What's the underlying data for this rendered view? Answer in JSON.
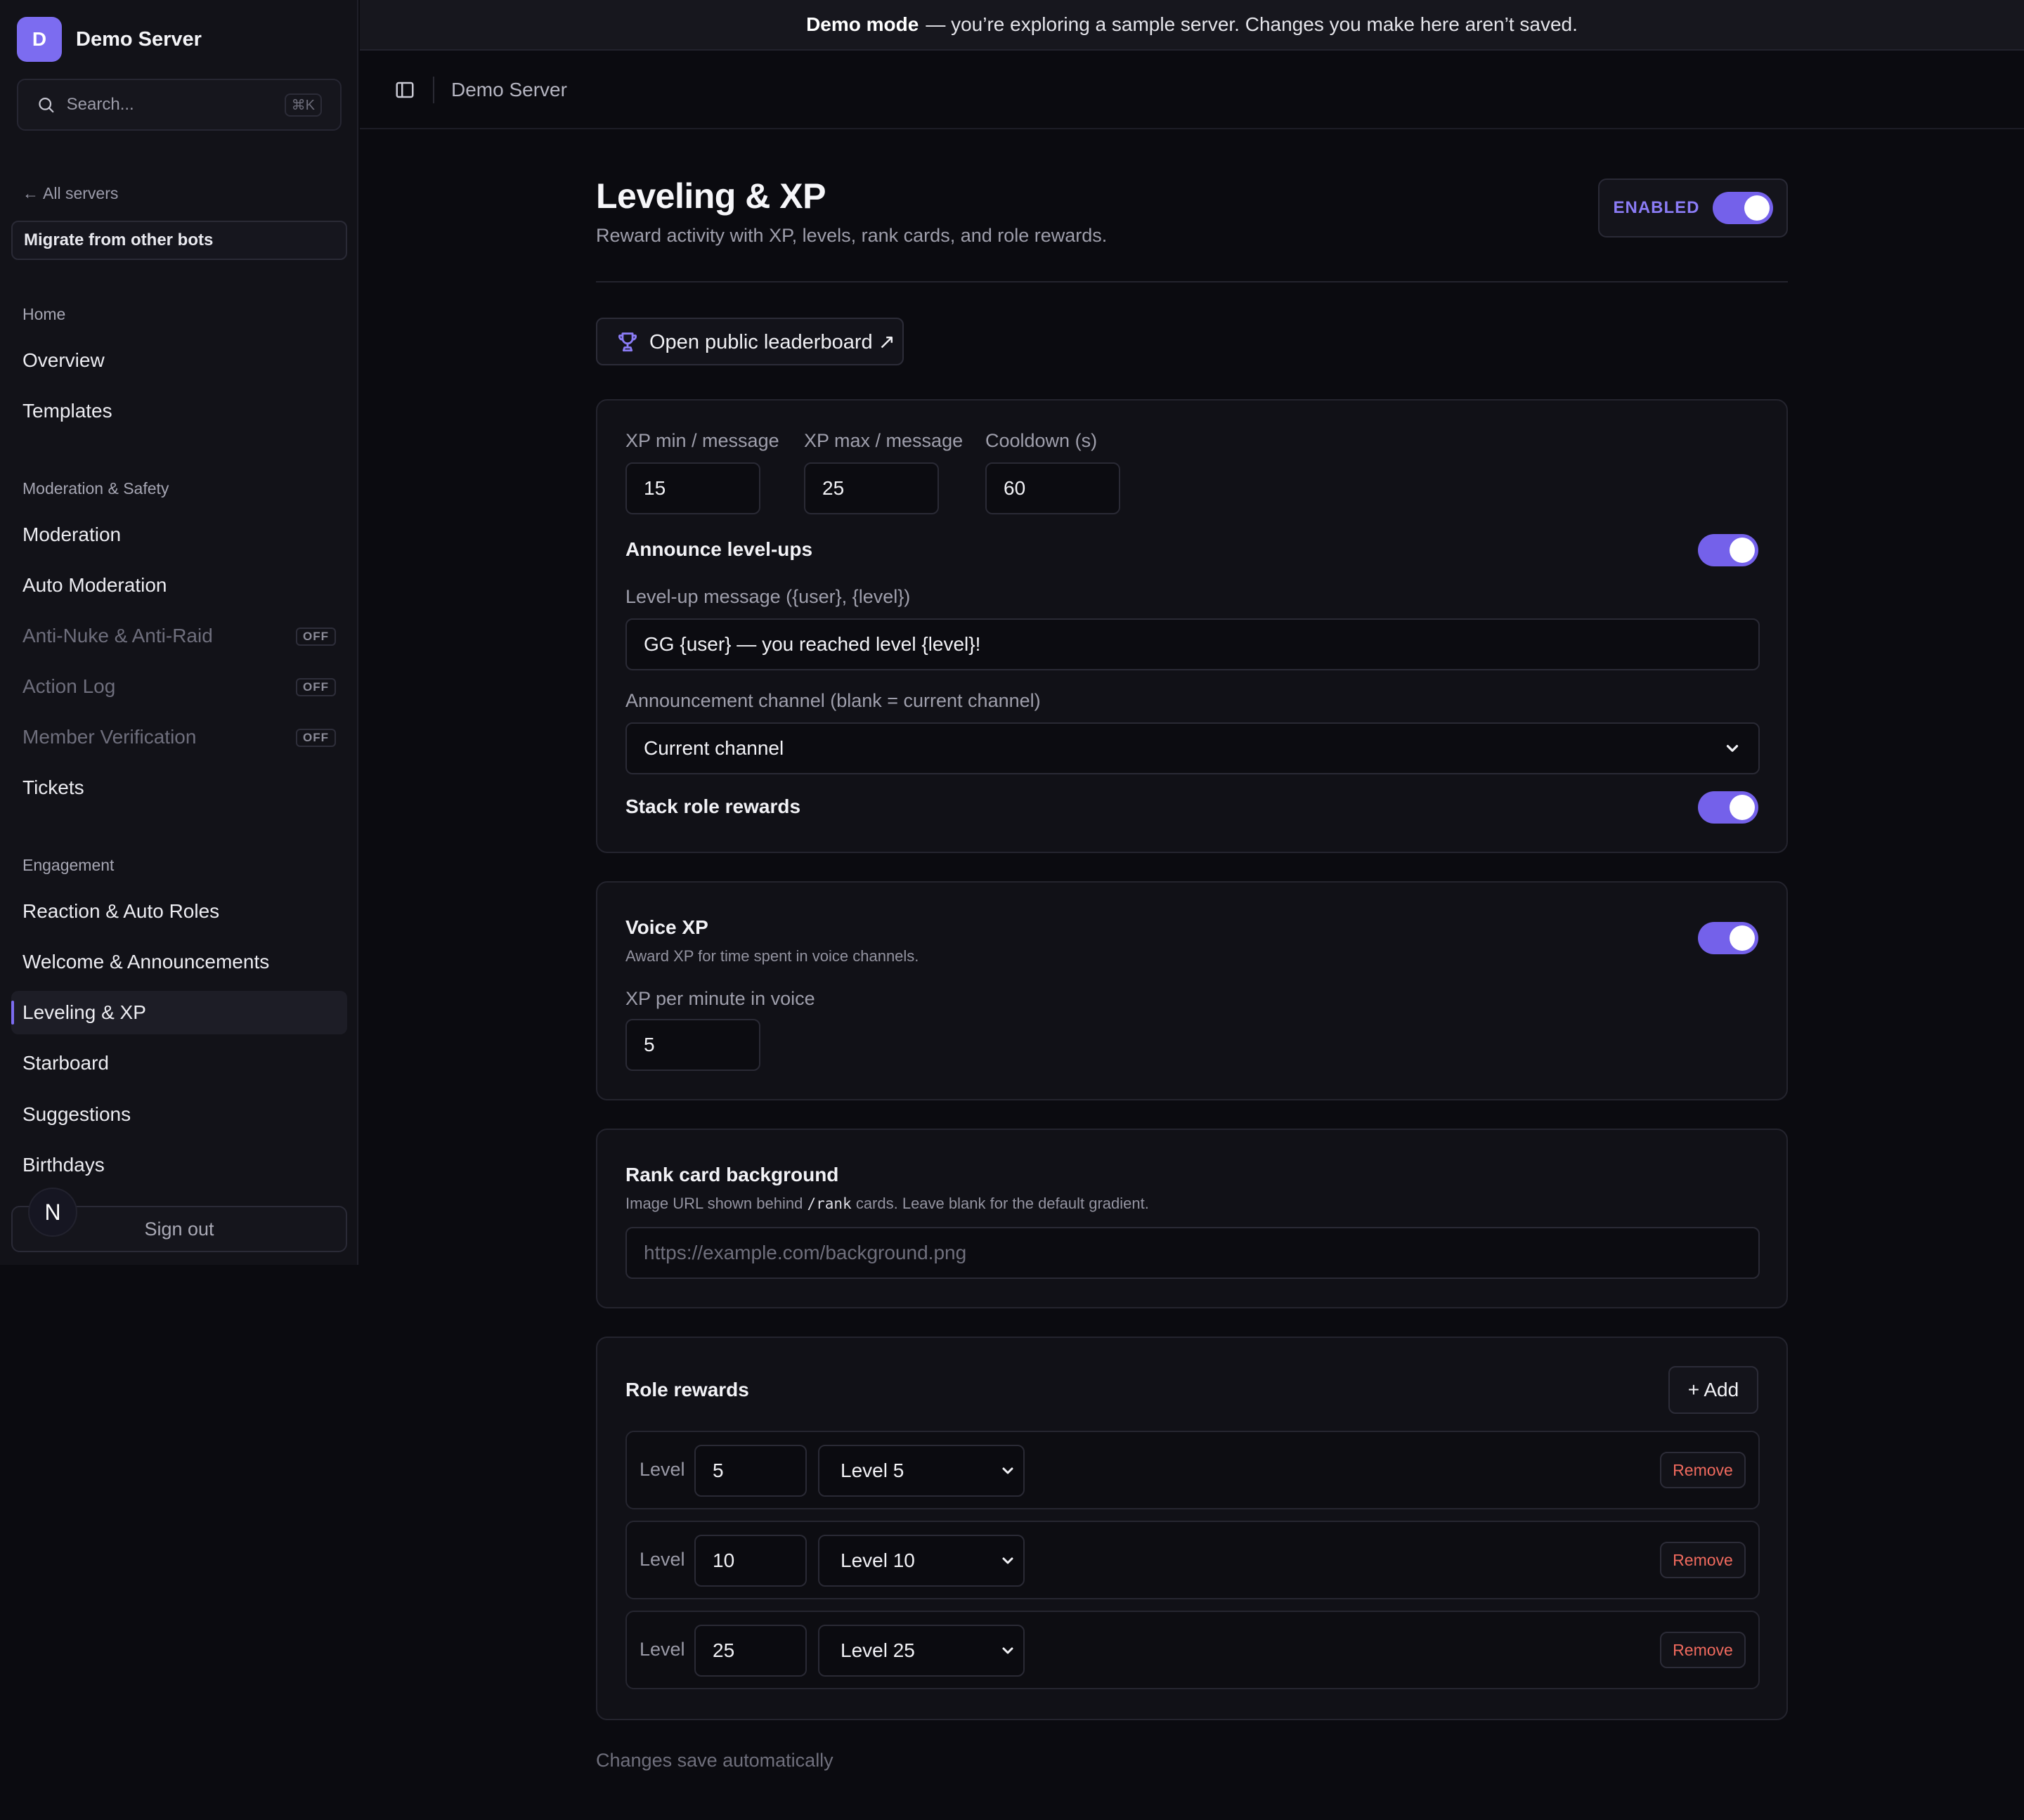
{
  "banner": {
    "bold": "Demo mode",
    "text": "— you’re exploring a sample server. Changes you make here aren’t saved."
  },
  "sidebar": {
    "server_initial": "D",
    "server_name": "Demo Server",
    "search_placeholder": "Search...",
    "search_shortcut": "⌘K",
    "all_servers": "All servers",
    "migrate": "Migrate from other bots",
    "sections": {
      "home": "Home",
      "moderation": "Moderation & Safety",
      "engagement": "Engagement"
    },
    "items": [
      {
        "label": "Overview"
      },
      {
        "label": "Templates"
      },
      {
        "label": "Moderation"
      },
      {
        "label": "Auto Moderation"
      },
      {
        "label": "Anti-Nuke & Anti-Raid",
        "badge": "OFF"
      },
      {
        "label": "Action Log",
        "badge": "OFF"
      },
      {
        "label": "Member Verification",
        "badge": "OFF"
      },
      {
        "label": "Tickets"
      },
      {
        "label": "Reaction & Auto Roles"
      },
      {
        "label": "Welcome & Announcements"
      },
      {
        "label": "Leveling & XP"
      },
      {
        "label": "Starboard"
      },
      {
        "label": "Suggestions"
      },
      {
        "label": "Birthdays"
      }
    ],
    "user_initial": "N",
    "sign_out": "Sign out"
  },
  "topbar": {
    "breadcrumb": "Demo Server"
  },
  "page": {
    "title": "Leveling & XP",
    "subtitle": "Reward activity with XP, levels, rank cards, and role rewards.",
    "enabled_label": "ENABLED",
    "leaderboard_button": "Open public leaderboard ↗"
  },
  "xp_settings": {
    "xp_min_label": "XP min / message",
    "xp_min_value": "15",
    "xp_max_label": "XP max / message",
    "xp_max_value": "25",
    "cooldown_label": "Cooldown (s)",
    "cooldown_value": "60",
    "announce_label": "Announce level-ups",
    "message_label": "Level-up message ({user}, {level})",
    "message_value": "GG {user} — you reached level {level}!",
    "channel_label": "Announcement channel (blank = current channel)",
    "channel_value": "Current channel",
    "stack_label": "Stack role rewards"
  },
  "voice": {
    "title": "Voice XP",
    "desc": "Award XP for time spent in voice channels.",
    "per_minute_label": "XP per minute in voice",
    "per_minute_value": "5"
  },
  "rank_card": {
    "title": "Rank card background",
    "desc_before": "Image URL shown behind",
    "desc_code": "/rank",
    "desc_after": "cards. Leave blank for the default gradient.",
    "placeholder": "https://example.com/background.png"
  },
  "role_rewards": {
    "title": "Role rewards",
    "add_label": "+ Add",
    "level_label": "Level",
    "remove_label": "Remove",
    "rows": [
      {
        "level": "5",
        "role": "Level 5"
      },
      {
        "level": "10",
        "role": "Level 10"
      },
      {
        "level": "25",
        "role": "Level 25"
      }
    ]
  },
  "footer_note": "Changes save automatically",
  "colors": {
    "accent": "#7461ea",
    "danger": "#f06a5e"
  }
}
